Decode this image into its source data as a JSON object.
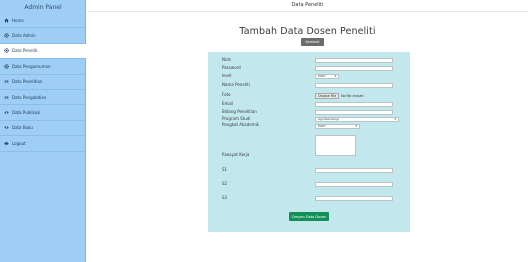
{
  "sidebar": {
    "title": "Admin Panel",
    "items": [
      {
        "label": "Home",
        "icon": "home-icon"
      },
      {
        "label": "Data Admin",
        "icon": "gear-icon"
      },
      {
        "label": "Data Peneliti",
        "icon": "gear-icon"
      },
      {
        "label": "Data Pengumuman",
        "icon": "gear-icon"
      },
      {
        "label": "Data Penelitian",
        "icon": "eye-icon"
      },
      {
        "label": "Data Pengabdian",
        "icon": "eye-icon"
      },
      {
        "label": "Data Publikasi",
        "icon": "eye-icon"
      },
      {
        "label": "Data Buku",
        "icon": "eye-icon"
      },
      {
        "label": "Logout",
        "icon": "logout-icon"
      }
    ]
  },
  "header": {
    "title": "Data Peneliti"
  },
  "page": {
    "title": "Tambah Data Dosen Peneliti",
    "back_label": "Kembali"
  },
  "form": {
    "labels": {
      "nidn": "Nidn",
      "password": "Password",
      "level": "level",
      "nama": "Nama Peneliti",
      "foto": "Foto",
      "email": "Email",
      "bidang": "Bidang Penelitian",
      "prodi": "Program Studi",
      "pangkat": "Pangkat Akademik",
      "riwayat": "Riwayat Kerja",
      "s1": "S1",
      "s2": "S2",
      "s3": "S3"
    },
    "level_value": "PILIH",
    "prodi_value": "Agroteknologi",
    "pangkat_value": "PILIH",
    "file_button": "Choose File",
    "file_status": "No file chosen",
    "submit_label": "Simpan Data Dosen"
  }
}
